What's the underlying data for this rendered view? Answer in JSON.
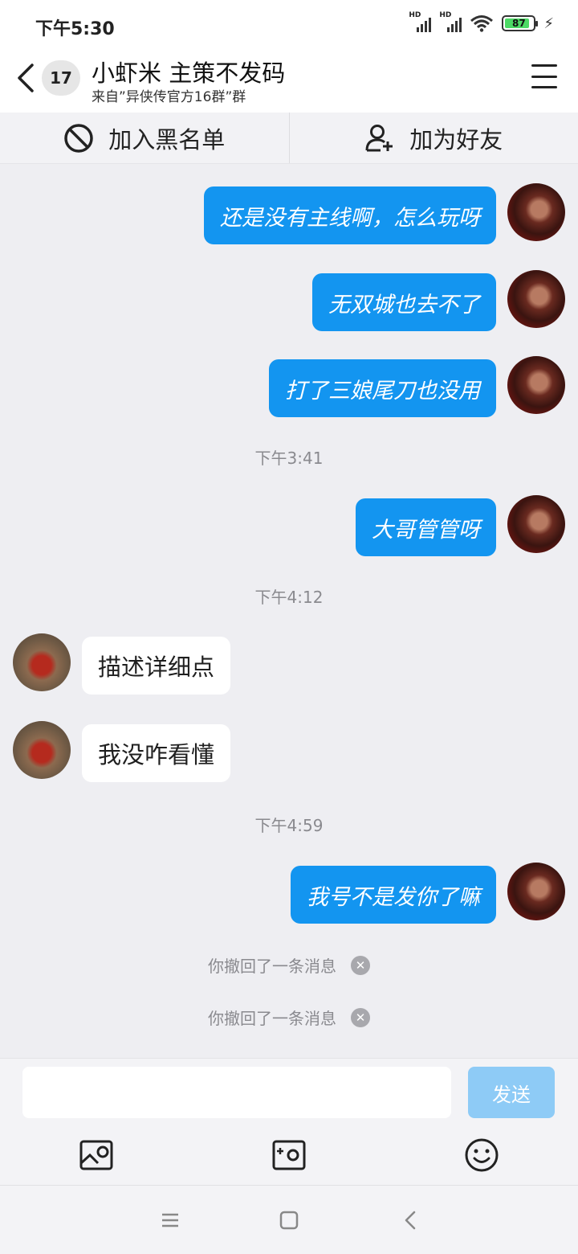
{
  "status_bar": {
    "time": "下午5:30",
    "signal_labels": [
      "HD",
      "HD"
    ],
    "battery_percent": "87",
    "battery_level": 0.87,
    "icons": [
      "signal-icon",
      "signal-icon",
      "wifi-icon",
      "battery-icon",
      "charging-bolt-icon"
    ]
  },
  "header": {
    "unread_count": "17",
    "title": "小虾米 主策不发码",
    "subtitle": "来自”异侠传官方16群”群"
  },
  "actions": {
    "block_label": "加入黑名单",
    "add_friend_label": "加为好友"
  },
  "messages": [
    {
      "type": "outgoing",
      "text": "还是没有主线啊，怎么玩呀"
    },
    {
      "type": "outgoing",
      "text": "无双城也去不了"
    },
    {
      "type": "outgoing",
      "text": "打了三娘尾刀也没用"
    },
    {
      "type": "timestamp",
      "text": "下午3:41"
    },
    {
      "type": "outgoing",
      "text": "大哥管管呀"
    },
    {
      "type": "timestamp",
      "text": "下午4:12"
    },
    {
      "type": "incoming",
      "text": "描述详细点"
    },
    {
      "type": "incoming",
      "text": "我没咋看懂"
    },
    {
      "type": "timestamp",
      "text": "下午4:59"
    },
    {
      "type": "outgoing",
      "text": "我号不是发你了嘛"
    },
    {
      "type": "recall",
      "text": "你撤回了一条消息"
    },
    {
      "type": "recall",
      "text": "你撤回了一条消息"
    }
  ],
  "composer": {
    "input_value": "",
    "send_label": "发送"
  },
  "colors": {
    "outgoing_bubble": "#1395f0",
    "incoming_bubble": "#ffffff",
    "chat_background": "#eeeef2",
    "send_button_disabled": "#8ecbf6"
  }
}
